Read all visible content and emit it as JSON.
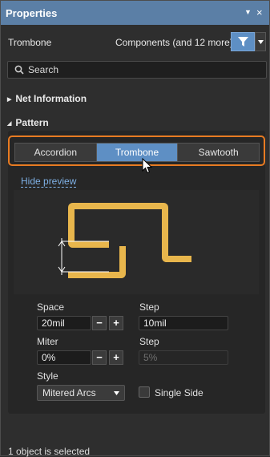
{
  "titlebar": {
    "title": "Properties",
    "pin_icon": "▼",
    "close_icon": "×"
  },
  "header": {
    "object_type": "Trombone",
    "filter_label": "Components (and 12 more)"
  },
  "search": {
    "placeholder": "Search"
  },
  "sections": {
    "net_information": "Net Information",
    "pattern": "Pattern"
  },
  "pattern_tabs": {
    "items": [
      "Accordion",
      "Trombone",
      "Sawtooth"
    ],
    "selected": "Trombone"
  },
  "preview": {
    "link_label": "Hide preview"
  },
  "fields": {
    "space_label": "Space",
    "space_value": "20mil",
    "step_label": "Step",
    "step_value": "10mil",
    "miter_label": "Miter",
    "miter_value": "0%",
    "step2_label": "Step",
    "step2_value": "5%",
    "style_label": "Style",
    "style_value": "Mitered Arcs",
    "single_side_label": "Single Side",
    "single_side_checked": false
  },
  "buttons": {
    "minus": "−",
    "plus": "+"
  },
  "status": {
    "text": "1 object is selected"
  },
  "colors": {
    "titlebar": "#5b7fa6",
    "accent": "#5e8fc4",
    "highlight": "#e87b22",
    "trace": "#e8b64c"
  }
}
